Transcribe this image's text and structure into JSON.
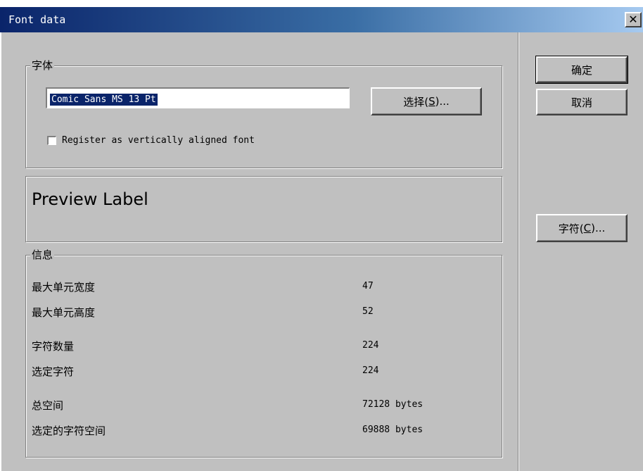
{
  "window": {
    "title": "Font data",
    "close_glyph": "✕"
  },
  "font_group": {
    "legend": "字体",
    "font_value": "Comic Sans MS 13 Pt",
    "select_button": {
      "label": "选择(",
      "accel": "S",
      "suffix": ")..."
    },
    "vertical_checkbox": {
      "label": "Register as vertically aligned font",
      "checked": false
    }
  },
  "preview": {
    "text": "Preview Label"
  },
  "info_group": {
    "legend": "信息",
    "rows": [
      {
        "label": "最大单元宽度",
        "value": "47"
      },
      {
        "label": "最大单元高度",
        "value": "52"
      },
      {
        "label": "字符数量",
        "value": "224"
      },
      {
        "label": "选定字符",
        "value": "224"
      },
      {
        "label": "总空间",
        "value": "72128 bytes"
      },
      {
        "label": "选定的字符空间",
        "value": "69888 bytes"
      }
    ]
  },
  "side_buttons": {
    "ok": "确定",
    "cancel": "取消",
    "chars": {
      "label": "字符(",
      "accel": "C",
      "suffix": ")..."
    }
  }
}
